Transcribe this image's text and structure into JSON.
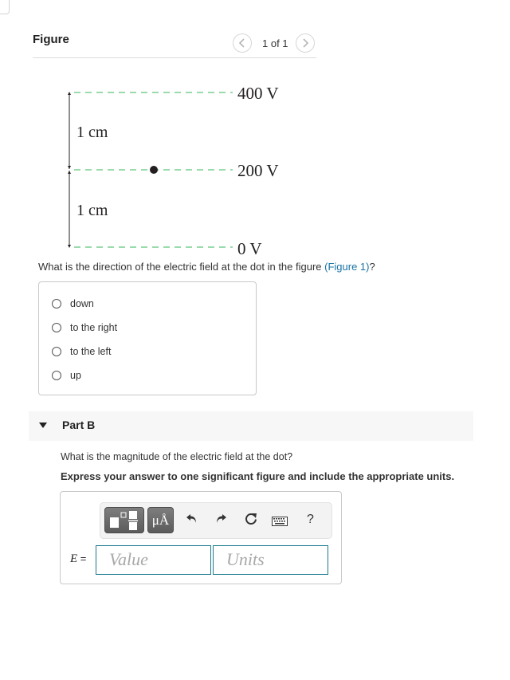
{
  "figure_panel": {
    "title": "Figure",
    "pager_text": "1 of 1",
    "prev_icon": "chevron-left-icon",
    "next_icon": "chevron-right-icon"
  },
  "figure": {
    "equipotential_labels": [
      "400 V",
      "200 V",
      "0 V"
    ],
    "spacing_labels": [
      "1 cm",
      "1 cm"
    ],
    "line_color": "#5cc57a",
    "dot_color": "#231f20"
  },
  "part_a": {
    "question_prefix": "What is the direction of the electric field at the dot in the figure ",
    "link_text": "(Figure 1)",
    "question_suffix": "?",
    "choices": [
      "down",
      "to the right",
      "to the left",
      "up"
    ]
  },
  "part_b": {
    "title": "Part B",
    "question": "What is the magnitude of the electric field at the dot?",
    "instruction": "Express your answer to one significant figure and include the appropriate units.",
    "toolbar": {
      "templates_icon": "templates-icon",
      "units_label": "μÅ",
      "undo_icon": "↶",
      "redo_icon": "↷",
      "reset_icon": "↻",
      "keyboard_icon": "keyboard-icon",
      "help_label": "?"
    },
    "variable": "E",
    "equals": "=",
    "value_placeholder": "Value",
    "units_placeholder": "Units"
  },
  "colors": {
    "link": "#1a74a5",
    "input_border": "#1a7a8c"
  }
}
